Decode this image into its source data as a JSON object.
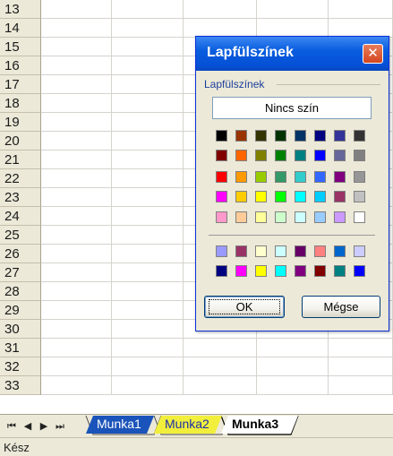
{
  "sheet": {
    "row_numbers": [
      "13",
      "14",
      "15",
      "16",
      "17",
      "18",
      "19",
      "20",
      "21",
      "22",
      "23",
      "24",
      "25",
      "26",
      "27",
      "28",
      "29",
      "30",
      "31",
      "32",
      "33"
    ]
  },
  "tabs": {
    "nav": [
      "⏮",
      "◀",
      "▶",
      "⏭"
    ],
    "items": [
      {
        "label": "Munka1",
        "color": "#1a53b9"
      },
      {
        "label": "Munka2",
        "color": "#f2ef3c"
      },
      {
        "label": "Munka3",
        "color": "#ffffff",
        "active": true
      }
    ]
  },
  "status": {
    "text": "Kész"
  },
  "dialog": {
    "title": "Lapfülszínek",
    "group_label": "Lapfülszínek",
    "no_color_label": "Nincs szín",
    "ok_label": "OK",
    "cancel_label": "Mégse",
    "close_icon": "close-icon",
    "palette_top": [
      [
        "#000000",
        "#993300",
        "#333300",
        "#003300",
        "#003366",
        "#000080",
        "#333399",
        "#333333"
      ],
      [
        "#800000",
        "#ff6600",
        "#808000",
        "#008000",
        "#008080",
        "#0000ff",
        "#666699",
        "#808080"
      ],
      [
        "#ff0000",
        "#ff9900",
        "#99cc00",
        "#339966",
        "#33cccc",
        "#3366ff",
        "#800080",
        "#969696"
      ],
      [
        "#ff00ff",
        "#ffcc00",
        "#ffff00",
        "#00ff00",
        "#00ffff",
        "#00ccff",
        "#993366",
        "#c0c0c0"
      ],
      [
        "#ff99cc",
        "#ffcc99",
        "#ffff99",
        "#ccffcc",
        "#ccffff",
        "#99ccff",
        "#cc99ff",
        "#ffffff"
      ]
    ],
    "palette_bottom": [
      [
        "#9999ff",
        "#993366",
        "#ffffcc",
        "#ccffff",
        "#660066",
        "#ff8080",
        "#0066cc",
        "#ccccff"
      ],
      [
        "#000080",
        "#ff00ff",
        "#ffff00",
        "#00ffff",
        "#800080",
        "#800000",
        "#008080",
        "#0000ff"
      ]
    ]
  }
}
